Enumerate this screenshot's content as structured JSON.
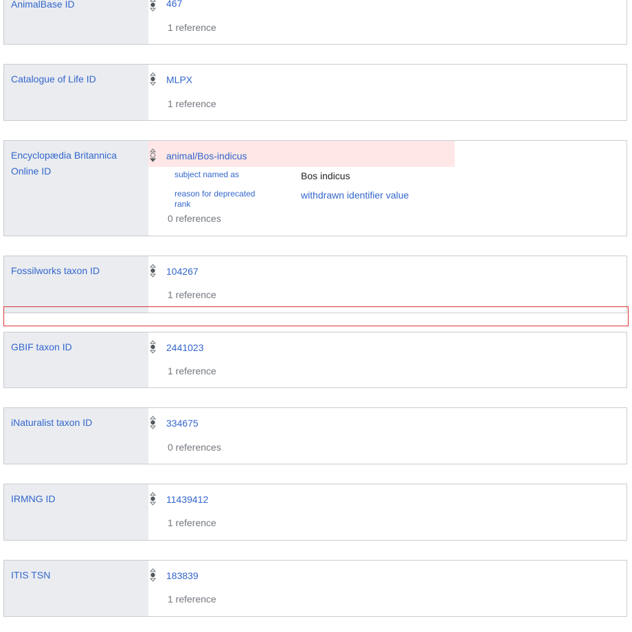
{
  "statements": [
    {
      "property": "AnimalBase ID",
      "value": "467",
      "references": "1 reference"
    },
    {
      "property": "Catalogue of Life ID",
      "value": "MLPX",
      "references": "1 reference"
    },
    {
      "property": "Encyclopædia Britannica Online ID",
      "value": "animal/Bos-indicus",
      "rank": "deprecated",
      "qualifiers": [
        {
          "label": "subject named as",
          "value": "Bos indicus"
        },
        {
          "label": "reason for deprecated rank",
          "value": "withdrawn identifier value"
        }
      ],
      "references": "0 references"
    },
    {
      "property": "Fossilworks taxon ID",
      "value": "104267",
      "references": "1 reference"
    },
    {
      "property": "GBIF taxon ID",
      "value": "2441023",
      "references": "1 reference"
    },
    {
      "property": "iNaturalist taxon ID",
      "value": "334675",
      "references": "0 references"
    },
    {
      "property": "IRMNG ID",
      "value": "11439412",
      "references": "1 reference"
    },
    {
      "property": "ITIS TSN",
      "value": "183839",
      "references": "1 reference"
    }
  ],
  "colors": {
    "link": "#3366cc",
    "label_bg": "#eaecf0",
    "deprecated_bg": "#fee7e6",
    "border": "#c8ccd1",
    "highlight_box": "#dd3333",
    "muted_text": "#72777d"
  },
  "icons": {
    "rank_normal": "rank-normal-icon",
    "rank_deprecated": "rank-deprecated-icon"
  }
}
